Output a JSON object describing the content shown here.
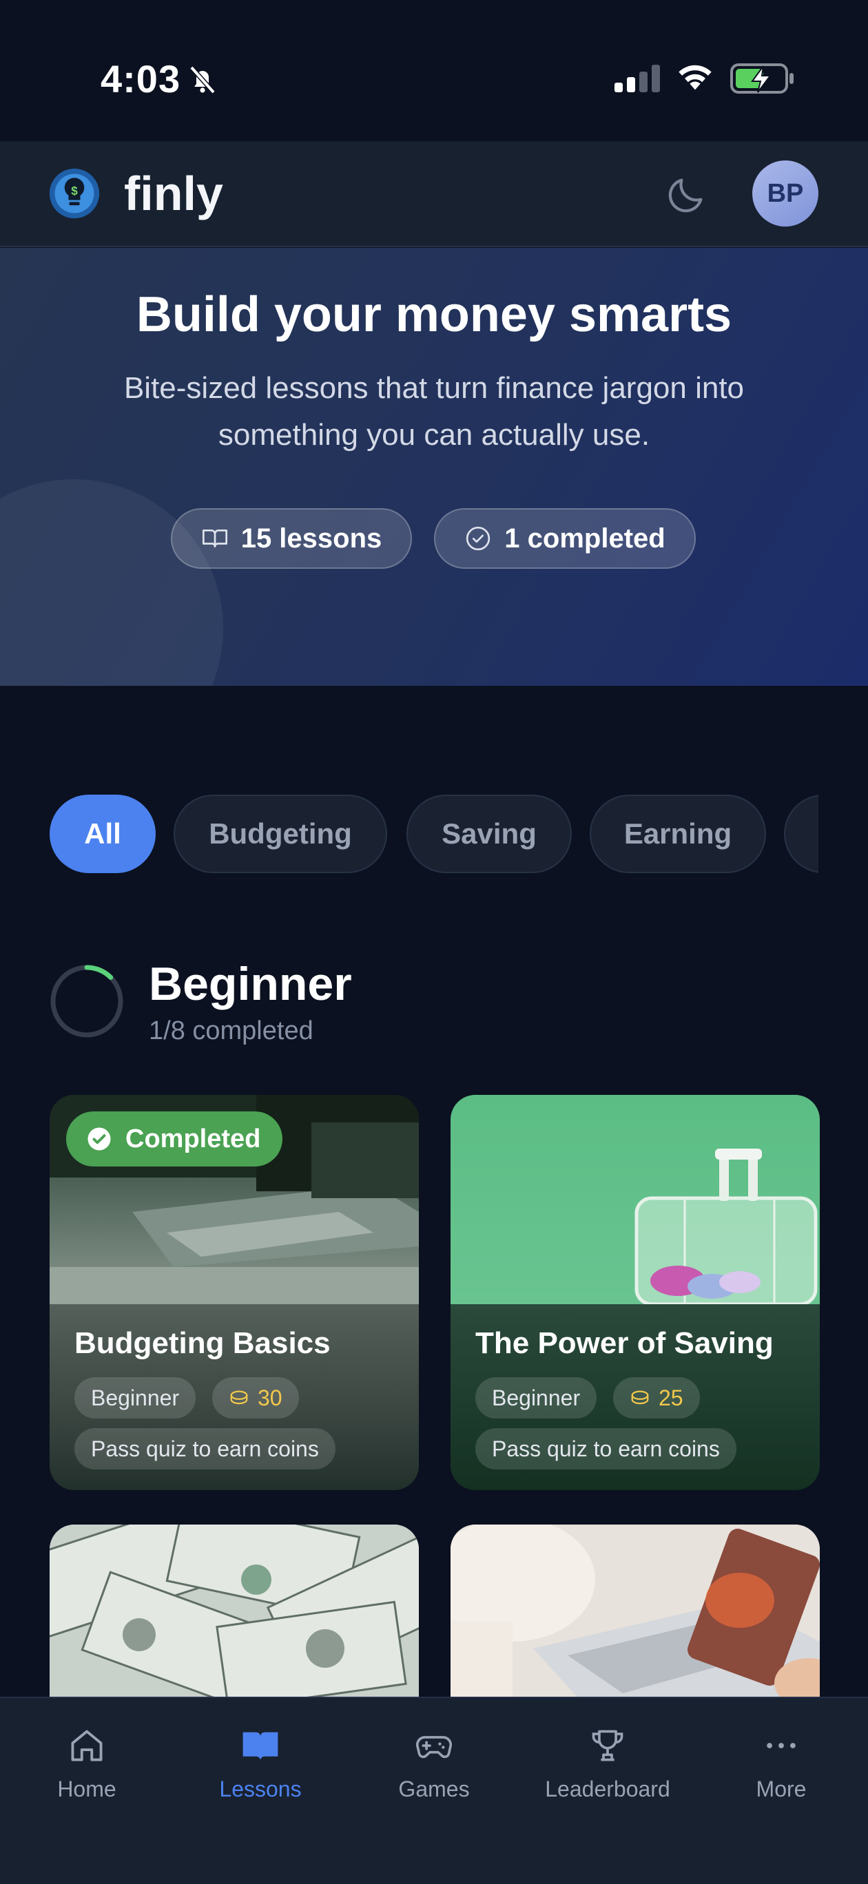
{
  "status_bar": {
    "time": "4:03"
  },
  "header": {
    "app_name": "finly",
    "avatar_initials": "BP"
  },
  "hero": {
    "title": "Build your money smarts",
    "subtitle": "Bite-sized lessons that turn finance jargon into something you can actually use.",
    "lessons_chip": "15 lessons",
    "completed_chip": "1 completed"
  },
  "filters": [
    "All",
    "Budgeting",
    "Saving",
    "Earning"
  ],
  "section": {
    "title": "Beginner",
    "subtitle": "1/8 completed",
    "progress": 0.125
  },
  "cards": [
    {
      "badge": "Completed",
      "title": "Budgeting Basics",
      "level": "Beginner",
      "coins": "30",
      "quiz": "Pass quiz to earn coins"
    },
    {
      "title": "The Power of Saving",
      "level": "Beginner",
      "coins": "25",
      "quiz": "Pass quiz to earn coins"
    }
  ],
  "tabs": [
    {
      "label": "Home",
      "icon": "home-icon"
    },
    {
      "label": "Lessons",
      "icon": "book-icon",
      "active": true
    },
    {
      "label": "Games",
      "icon": "gamepad-icon"
    },
    {
      "label": "Leaderboard",
      "icon": "trophy-icon"
    },
    {
      "label": "More",
      "icon": "more-icon"
    }
  ],
  "colors": {
    "background": "#0b1120",
    "accent": "#4c82ef",
    "success": "#4aa252",
    "coin": "#f1c84b"
  }
}
